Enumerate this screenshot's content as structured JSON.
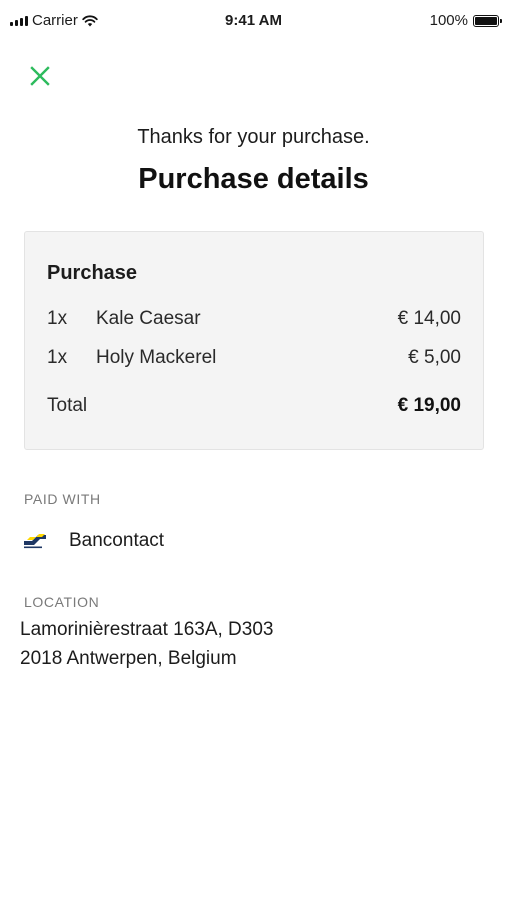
{
  "status_bar": {
    "carrier": "Carrier",
    "time": "9:41 AM",
    "battery": "100%"
  },
  "header": {
    "subtitle": "Thanks for your purchase.",
    "title": "Purchase details"
  },
  "purchase": {
    "heading": "Purchase",
    "items": [
      {
        "qty": "1x",
        "name": "Kale Caesar",
        "price": "€ 14,00"
      },
      {
        "qty": "1x",
        "name": "Holy Mackerel",
        "price": "€ 5,00"
      }
    ],
    "total_label": "Total",
    "total_value": "€ 19,00"
  },
  "payment": {
    "label": "PAID WITH",
    "method": "Bancontact",
    "icon": "bancontact-logo-icon"
  },
  "location": {
    "label": "LOCATION",
    "line1": "Lamorinièrestraat 163A, D303",
    "line2": "2018 Antwerpen, Belgium"
  },
  "colors": {
    "accent": "#2dbb5d",
    "card_bg": "#f4f4f4",
    "label_gray": "#7a7a7a"
  }
}
